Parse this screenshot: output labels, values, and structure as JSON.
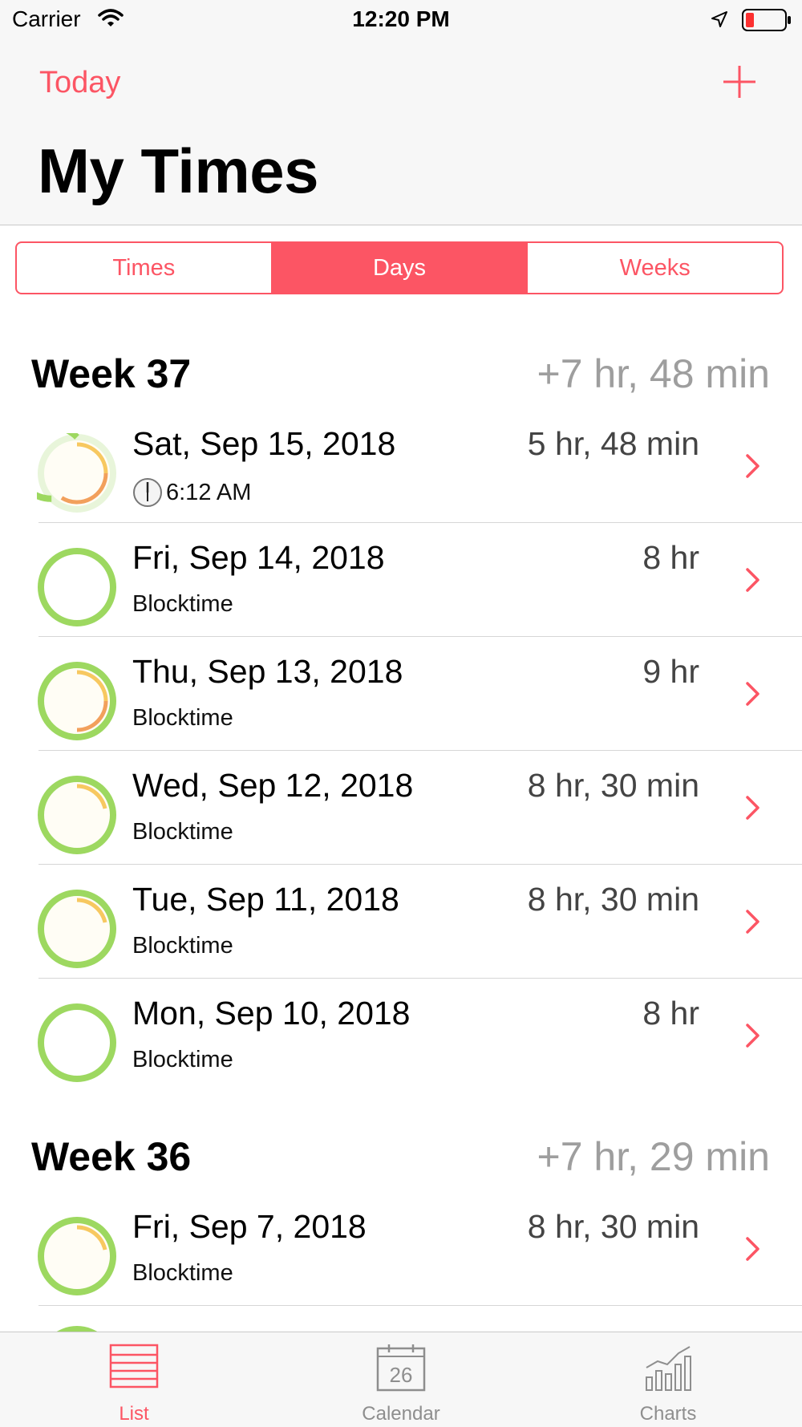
{
  "status_bar": {
    "carrier": "Carrier",
    "time": "12:20 PM"
  },
  "nav": {
    "today_label": "Today",
    "title": "My Times"
  },
  "segmented": {
    "options": [
      "Times",
      "Days",
      "Weeks"
    ],
    "selected": "Days"
  },
  "sections": [
    {
      "title": "Week 37",
      "total": "+7 hr, 48 min",
      "rows": [
        {
          "date": "Sat, Sep 15, 2018",
          "duration": "5 hr, 48 min",
          "subtitle": "6:12 AM"
        },
        {
          "date": "Fri, Sep 14, 2018",
          "duration": "8 hr",
          "subtitle": "Blocktime"
        },
        {
          "date": "Thu, Sep 13, 2018",
          "duration": "9 hr",
          "subtitle": "Blocktime"
        },
        {
          "date": "Wed, Sep 12, 2018",
          "duration": "8 hr, 30 min",
          "subtitle": "Blocktime"
        },
        {
          "date": "Tue, Sep 11, 2018",
          "duration": "8 hr, 30 min",
          "subtitle": "Blocktime"
        },
        {
          "date": "Mon, Sep 10, 2018",
          "duration": "8 hr",
          "subtitle": "Blocktime"
        }
      ]
    },
    {
      "title": "Week 36",
      "total": "+7 hr, 29 min",
      "rows": [
        {
          "date": "Fri, Sep 7, 2018",
          "duration": "8 hr, 30 min",
          "subtitle": "Blocktime"
        }
      ]
    }
  ],
  "tabs": [
    {
      "label": "List",
      "active": true
    },
    {
      "label": "Calendar",
      "active": false,
      "icon_text": "26"
    },
    {
      "label": "Charts",
      "active": false
    }
  ],
  "colors": {
    "accent": "#fc5564",
    "ring_green": "#9dd860",
    "ring_orange": "#f2a05c",
    "ring_yellow": "#f7c860",
    "secondary_text": "#9e9e9e"
  },
  "icons": [
    "wifi-icon",
    "location-arrow-icon",
    "battery-icon",
    "plus-icon",
    "progress-ring-icon",
    "clock-icon",
    "chevron-right-icon",
    "list-icon",
    "calendar-icon",
    "charts-icon"
  ]
}
